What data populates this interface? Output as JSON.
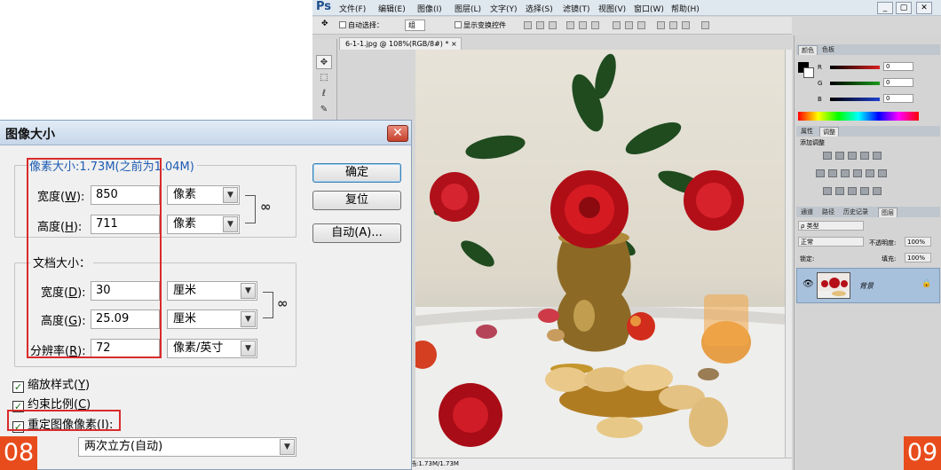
{
  "photoshop": {
    "logo": "Ps",
    "menu": [
      "文件(F)",
      "编辑(E)",
      "图像(I)",
      "图层(L)",
      "文字(Y)",
      "选择(S)",
      "滤镜(T)",
      "视图(V)",
      "窗口(W)",
      "帮助(H)"
    ],
    "window_buttons": [
      "_",
      "▢",
      "✕"
    ],
    "options": {
      "auto_select": "自动选择：",
      "group_value": "组",
      "show_transform": "显示变换控件"
    },
    "doc_tab": "6-1-1.jpg @ 108%(RGB/8#) * ×",
    "status": "档:1.73M/1.73M",
    "panels": {
      "color_tabs": [
        "颜色",
        "色板"
      ],
      "sliders": [
        {
          "channel": "R",
          "value": "0",
          "color": "#d92020"
        },
        {
          "channel": "G",
          "value": "0",
          "color": "#1a9a1a"
        },
        {
          "channel": "B",
          "value": "0",
          "color": "#2040d0"
        }
      ],
      "adjust_tabs": [
        "属性",
        "调整"
      ],
      "adjust_title": "添加调整",
      "layer_tabs": [
        "通道",
        "路径",
        "历史记录",
        "图层"
      ],
      "kind_label": "ρ 类型",
      "blend_mode": "正常",
      "opacity_label": "不透明度:",
      "opacity_value": "100%",
      "lock_label": "锁定:",
      "fill_label": "填充:",
      "fill_value": "100%",
      "layer_name": "背景"
    }
  },
  "dialog": {
    "title": "图像大小",
    "close_label": "✕",
    "pixel_dimensions_label": "像素大小:1.73M(之前为1.04M)",
    "pixel_width": {
      "label": "宽度(",
      "key": "W",
      "suffix": "):",
      "value": "850",
      "unit": "像素"
    },
    "pixel_height": {
      "label": "高度(",
      "key": "H",
      "suffix": "):",
      "value": "711",
      "unit": "像素"
    },
    "document_size_label": "文档大小：",
    "doc_width": {
      "label": "宽度(",
      "key": "D",
      "suffix": "):",
      "value": "30",
      "unit": "厘米"
    },
    "doc_height": {
      "label": "高度(",
      "key": "G",
      "suffix": "):",
      "value": "25.09",
      "unit": "厘米"
    },
    "resolution": {
      "label": "分辨率(",
      "key": "R",
      "suffix": "):",
      "value": "72",
      "unit": "像素/英寸"
    },
    "buttons": {
      "ok": "确定",
      "reset": "复位",
      "auto": "自动(A)..."
    },
    "scale_styles": {
      "label": "缩放样式(",
      "key": "Y",
      "suffix": ")",
      "checked": true
    },
    "constrain": {
      "label": "约束比例(",
      "key": "C",
      "suffix": ")",
      "checked": true
    },
    "resample": {
      "label": "重定图像像素(",
      "key": "I",
      "suffix": "):",
      "checked": true
    },
    "resample_method": "两次立方(自动)",
    "check_mark": "✓"
  },
  "badges": {
    "left": "08",
    "right": "09"
  }
}
